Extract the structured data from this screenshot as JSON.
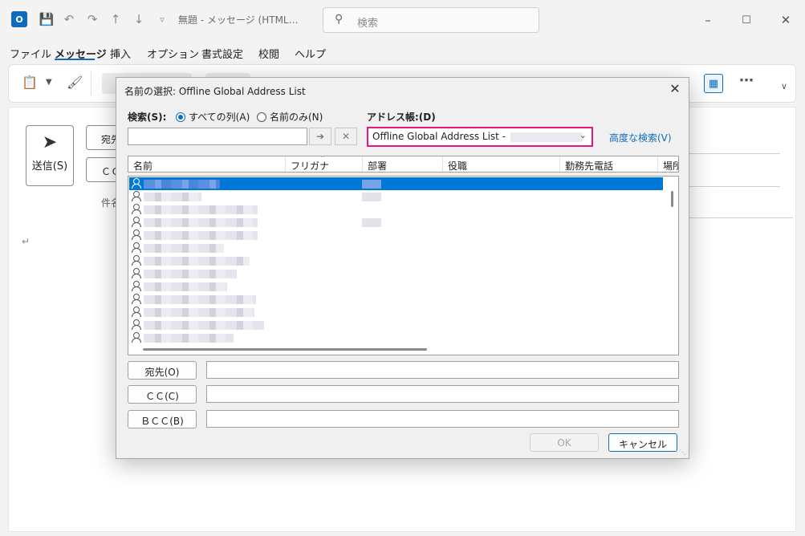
{
  "window": {
    "title": "無題 - メッセージ (HTML…",
    "search_placeholder": "検索",
    "app_icon_letter": "O"
  },
  "menu": {
    "items": [
      "ファイル",
      "メッセージ",
      "挿入",
      "オプション",
      "書式設定",
      "校閲",
      "ヘルプ"
    ]
  },
  "compose": {
    "send_label": "送信(S)",
    "to_label": "宛先",
    "cc_label": "ＣＣ",
    "subject_label": "件名"
  },
  "dialog": {
    "title": "名前の選択: Offline Global Address List",
    "search_label": "検索(S):",
    "radio_all": "すべての列(A)",
    "radio_name": "名前のみ(N)",
    "addressbook_label": "アドレス帳:(D)",
    "addressbook_value": "Offline Global Address List -",
    "advanced_search": "高度な検索(V)",
    "columns": [
      "名前",
      "フリガナ",
      "部署",
      "役職",
      "勤務先電話",
      "場所"
    ],
    "to_button": "宛先(O)",
    "cc_button": "ＣＣ(C)",
    "bcc_button": "ＢＣＣ(B)",
    "ok_label": "OK",
    "cancel_label": "キャンセル"
  },
  "theme": {
    "accent": "#0f6cbd",
    "selection": "#0078d7",
    "highlight_border": "#e8177d"
  }
}
